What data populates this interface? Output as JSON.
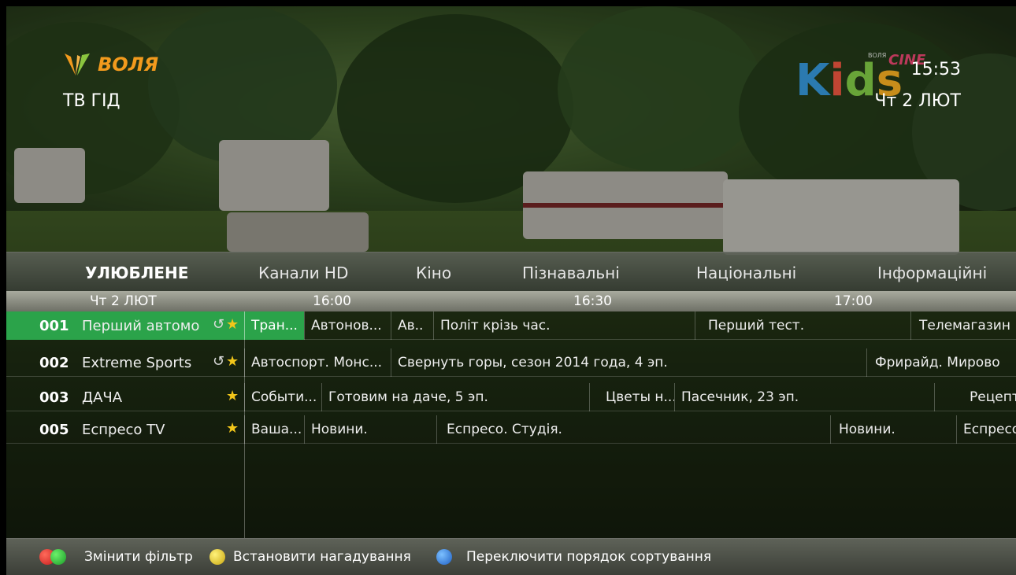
{
  "header": {
    "brand": "ВОЛЯ",
    "title": "ТВ ГІД",
    "channel_logo": {
      "main": "Kids",
      "sub": "CINE",
      "small": "ВОЛЯ"
    },
    "time": "15:53",
    "date": "Чт 2 ЛЮТ"
  },
  "tabs": [
    {
      "label": "УЛЮБЛЕНЕ",
      "active": true
    },
    {
      "label": "Канали HD",
      "active": false
    },
    {
      "label": "Кіно",
      "active": false
    },
    {
      "label": "Пізнавальні",
      "active": false
    },
    {
      "label": "Національні",
      "active": false
    },
    {
      "label": "Інформаційні",
      "active": false
    }
  ],
  "ruler": {
    "date": "Чт 2 ЛЮТ",
    "times": [
      "16:00",
      "16:30",
      "17:00"
    ]
  },
  "channels": [
    {
      "number": "001",
      "name": "Перший автомо",
      "repeat": true,
      "favorite": true,
      "selected": true,
      "programs": [
        "Тран...",
        "Автонов...",
        "Ав...",
        "Політ крізь час.",
        "Перший тест.",
        "Телемагазин"
      ]
    },
    {
      "number": "002",
      "name": "Extreme Sports",
      "repeat": true,
      "favorite": true,
      "selected": false,
      "programs": [
        "Автоспорт. Монс...",
        "Свернуть горы, сезон 2014 года, 4 эп.",
        "Фрирайд. Мирово"
      ]
    },
    {
      "number": "003",
      "name": "ДАЧА",
      "repeat": false,
      "favorite": true,
      "selected": false,
      "programs": [
        "Событи...",
        "Готовим на даче, 5 эп.",
        "Цветы н...",
        "Пасечник, 23 эп.",
        "Рецепт"
      ]
    },
    {
      "number": "005",
      "name": "Еспресо TV",
      "repeat": false,
      "favorite": true,
      "selected": false,
      "programs": [
        "Ваша...",
        "Новини.",
        "Еспресо. Студія.",
        "Новини.",
        "Еспресо"
      ]
    }
  ],
  "footer": {
    "filter_label": "Змінити фільтр",
    "reminder_label": "Встановити нагадування",
    "sort_label": "Переключити порядок сортування"
  },
  "colors": {
    "accent_green": "#2ba34a",
    "brand_orange": "#f29a1d",
    "red_button": "#e02a2a",
    "green_button": "#2cc33c",
    "yellow_button": "#e6c619",
    "blue_button": "#2a7fe0"
  }
}
